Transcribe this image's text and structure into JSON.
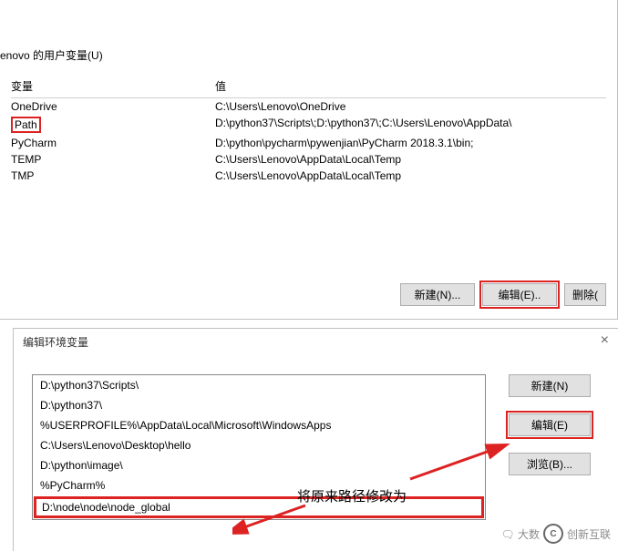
{
  "section_title": "enovo 的用户变量(U)",
  "table": {
    "headers": {
      "var": "变量",
      "val": "值"
    },
    "rows": [
      {
        "var": "OneDrive",
        "val": "C:\\Users\\Lenovo\\OneDrive"
      },
      {
        "var": "Path",
        "val": "D:\\python37\\Scripts\\;D:\\python37\\;C:\\Users\\Lenovo\\AppData\\"
      },
      {
        "var": "PyCharm",
        "val": "D:\\python\\pycharm\\pywenjian\\PyCharm 2018.3.1\\bin;"
      },
      {
        "var": "TEMP",
        "val": "C:\\Users\\Lenovo\\AppData\\Local\\Temp"
      },
      {
        "var": "TMP",
        "val": "C:\\Users\\Lenovo\\AppData\\Local\\Temp"
      }
    ]
  },
  "top_buttons": {
    "new": "新建(N)...",
    "edit": "编辑(E)..",
    "delete": "删除("
  },
  "edit_dialog": {
    "title": "编辑环境变量",
    "items": [
      "D:\\python37\\Scripts\\",
      "D:\\python37\\",
      "%USERPROFILE%\\AppData\\Local\\Microsoft\\WindowsApps",
      "C:\\Users\\Lenovo\\Desktop\\hello",
      "D:\\python\\image\\",
      "%PyCharm%",
      "D:\\node\\node\\node_global"
    ],
    "buttons": {
      "new": "新建(N)",
      "edit": "编辑(E)",
      "browse": "浏览(B)..."
    }
  },
  "annotation": "将原来路径修改为",
  "watermark": {
    "prefix": "🗨 大数",
    "brand": "创新互联"
  }
}
